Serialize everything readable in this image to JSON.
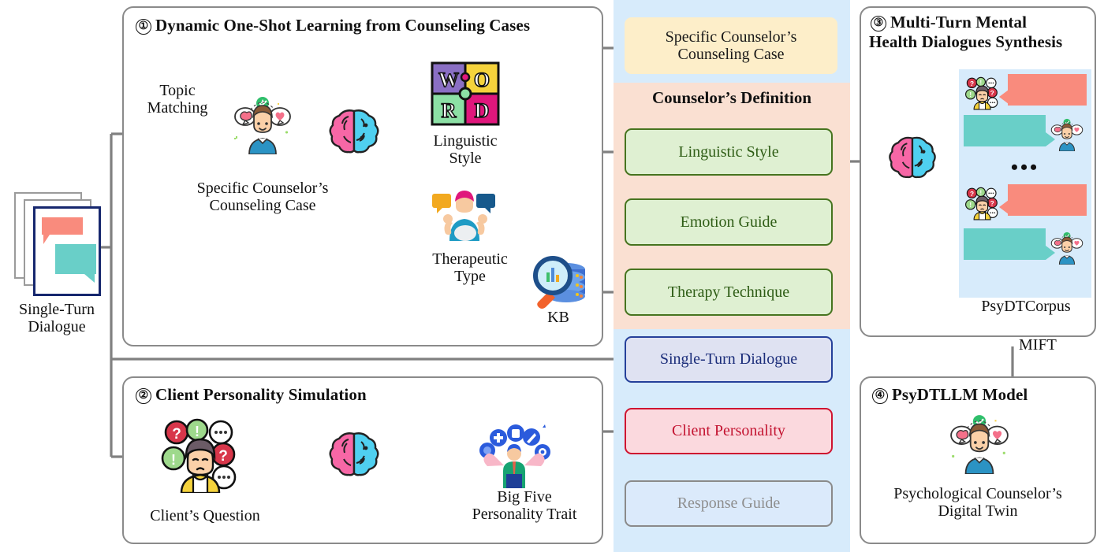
{
  "figure": {
    "type": "pipeline-diagram",
    "title": "PsyDT framework pipeline"
  },
  "input": {
    "label": "Single-Turn\nDialogue",
    "label_line1": "Single-Turn",
    "label_line2": "Dialogue",
    "icon": "document-stack-icon"
  },
  "sections": {
    "one": {
      "number": "①",
      "title": "Dynamic One-Shot Learning from Counseling Cases",
      "edge_label": "Topic\nMatching",
      "edge_label_l1": "Topic",
      "edge_label_l2": "Matching",
      "node_counselor_l1": "Specific Counselor’s",
      "node_counselor_l2": "Counseling Case",
      "branch_a_l1": "Linguistic",
      "branch_a_l2": "Style",
      "branch_b_l1": "Therapeutic",
      "branch_b_l2": "Type",
      "kb_label": "KB"
    },
    "two": {
      "number": "②",
      "title": "Client Personality Simulation",
      "node_question": "Client’s Question",
      "node_bigfive_l1": "Big Five",
      "node_bigfive_l2": "Personality Trait"
    },
    "three": {
      "number": "③",
      "title_l1": "Multi-Turn Mental",
      "title_l2": "Health Dialogues Synthesis",
      "corpus_label": "PsyDTCorpus",
      "ellipsis": "•••"
    },
    "four": {
      "number": "④",
      "title": "PsyDTLLM Model",
      "caption_l1": "Psychological Counselor’s",
      "caption_l2": "Digital Twin"
    }
  },
  "transitions": {
    "mift": "MIFT"
  },
  "middle_column": {
    "cards": [
      {
        "id": "specific-counselors-counseling-case",
        "line1": "Specific Counselor’s",
        "line2": "Counseling Case",
        "style": "cream"
      },
      {
        "id": "linguistic-style",
        "line1": "Linguistic Style",
        "line2": "",
        "style": "green"
      },
      {
        "id": "emotion-guide",
        "line1": "Emotion Guide",
        "line2": "",
        "style": "green"
      },
      {
        "id": "therapy-technique",
        "line1": "Therapy Technique",
        "line2": "",
        "style": "green"
      },
      {
        "id": "single-turn-dialogue",
        "line1": "Single-Turn Dialogue",
        "line2": "",
        "style": "blue"
      },
      {
        "id": "client-personality",
        "line1": "Client Personality",
        "line2": "",
        "style": "red"
      },
      {
        "id": "response-guide",
        "line1": "Response Guide",
        "line2": "",
        "style": "gray"
      }
    ],
    "group_header": "Counselor’s Definition"
  },
  "colors": {
    "column_background": "#d7ebfb",
    "definition_background": "#fae0d2",
    "cream_card": "#fdeec9",
    "green_card_fill": "#dff0d2",
    "green_card_border": "#46741f",
    "blue_card_fill": "#dfe2f2",
    "blue_card_border": "#25409a",
    "red_card_fill": "#fbd9de",
    "red_card_border": "#cf1430",
    "gray_card_border": "#8a8a8a",
    "arrow": "#808080",
    "panel_border": "#8a8a8a",
    "client_bubble": "#f98b7d",
    "counselor_bubble": "#69cfc8",
    "brain_left": "#f767a6",
    "brain_right": "#4fd0f0"
  }
}
